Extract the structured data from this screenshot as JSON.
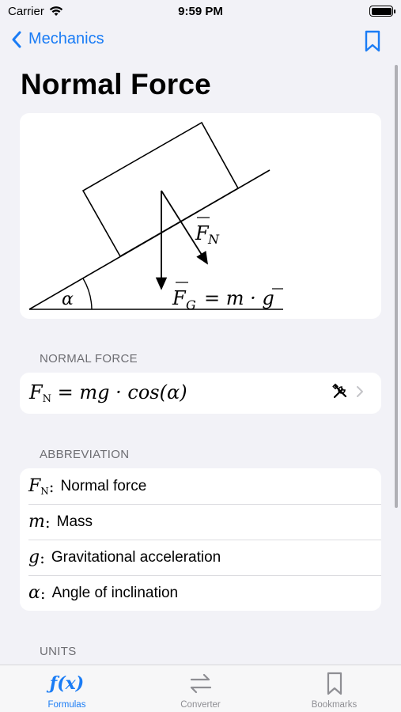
{
  "status": {
    "carrier": "Carrier",
    "time": "9:59 PM",
    "battery_level": 1.0
  },
  "nav": {
    "back_label": "Mechanics"
  },
  "page": {
    "title": "Normal Force"
  },
  "diagram": {
    "angle_label": "α",
    "normal_force_label": "F",
    "normal_force_sub": "N",
    "gravity_label": "F",
    "gravity_sub": "G",
    "gravity_equation": "= m · g"
  },
  "sections": {
    "normal_force": "NORMAL FORCE",
    "abbreviation": "ABBREVIATION",
    "units": "UNITS"
  },
  "formula": {
    "lhs": "F",
    "lhs_sub": "N",
    "rhs": "= mg · cos(α)"
  },
  "abbreviations": [
    {
      "symbol": "F",
      "sub": "N",
      "label": "Normal force"
    },
    {
      "symbol": "m",
      "sub": "",
      "label": "Mass"
    },
    {
      "symbol": "g",
      "sub": "",
      "label": "Gravitational acceleration"
    },
    {
      "symbol": "α",
      "sub": "",
      "label": "Angle of inclination"
    }
  ],
  "tabs": [
    {
      "label": "Formulas",
      "icon": "function-icon",
      "active": true
    },
    {
      "label": "Converter",
      "icon": "arrows-left-right-icon",
      "active": false
    },
    {
      "label": "Bookmarks",
      "icon": "bookmark-icon",
      "active": false
    }
  ],
  "colors": {
    "accent": "#1a7cf5",
    "background": "#f2f2f7",
    "inactive": "#8e8e93"
  }
}
